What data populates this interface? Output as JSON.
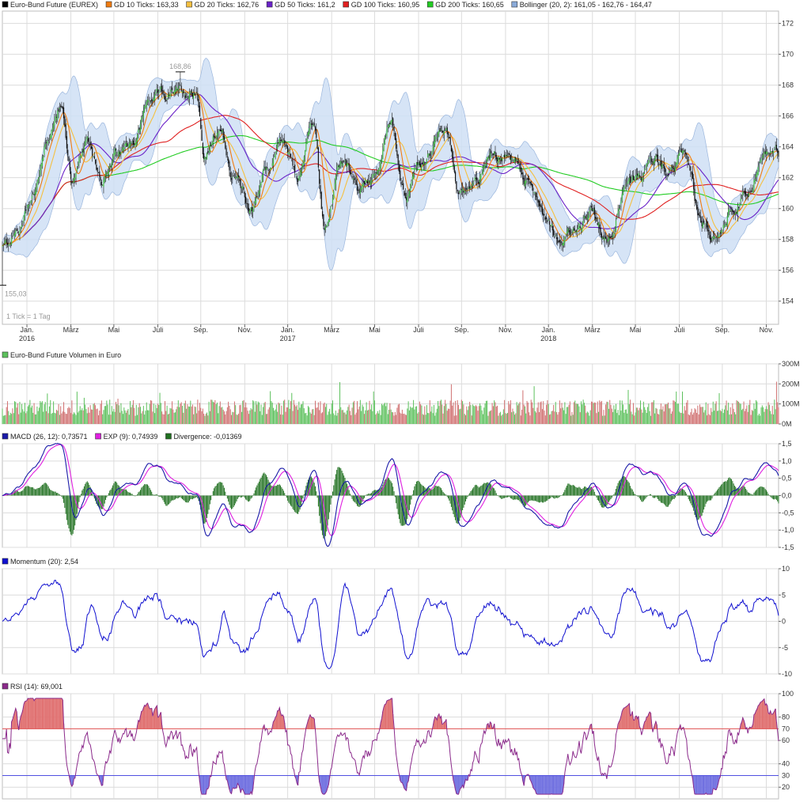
{
  "colors": {
    "ma10": "#f07b10",
    "ma20": "#f5c040",
    "ma50": "#6a22c8",
    "ma100": "#e02020",
    "ma200": "#22cc22",
    "bollinger_fill": "#cfe0f5",
    "bollinger_edge": "#8aaad8",
    "macd": "#1a1aa8",
    "exp": "#e020e0",
    "divergence": "#207020",
    "momentum": "#1010d0",
    "rsi": "#8b2a8b",
    "rsi_70": "#e05050",
    "rsi_30": "#5050e0",
    "vol_up": "#5cc05c",
    "vol_down": "#d07070",
    "grid": "#dcdcdc"
  },
  "chart_data": [
    {
      "type": "candlestick",
      "legend": [
        {
          "text": "Euro-Bund Future (EUREX)",
          "color": "#000000"
        },
        {
          "text": "GD 10 Ticks: 163,33",
          "color": "#f07b10"
        },
        {
          "text": "GD 20 Ticks: 162,76",
          "color": "#f5c040"
        },
        {
          "text": "GD 50 Ticks: 161,2",
          "color": "#6a22c8"
        },
        {
          "text": "GD 100 Ticks: 160,95",
          "color": "#e02020"
        },
        {
          "text": "GD 200 Ticks: 160,65",
          "color": "#22cc22"
        },
        {
          "text": "Bollinger (20, 2): 161,05 - 162,76 - 164,47",
          "color": "#8aaad8"
        }
      ],
      "ylim": [
        152.5,
        172.8
      ],
      "y_ticks": [
        "154",
        "156",
        "158",
        "160",
        "162",
        "164",
        "166",
        "168",
        "170",
        "172"
      ],
      "x_ticks": [
        {
          "label": "Jan.",
          "sub": "2016"
        },
        {
          "label": "März",
          "sub": ""
        },
        {
          "label": "Mai",
          "sub": ""
        },
        {
          "label": "Juli",
          "sub": ""
        },
        {
          "label": "Sep.",
          "sub": ""
        },
        {
          "label": "Nov.",
          "sub": ""
        },
        {
          "label": "Jan.",
          "sub": "2017"
        },
        {
          "label": "März",
          "sub": ""
        },
        {
          "label": "Mai",
          "sub": ""
        },
        {
          "label": "Juli",
          "sub": ""
        },
        {
          "label": "Sep.",
          "sub": ""
        },
        {
          "label": "Nov.",
          "sub": ""
        },
        {
          "label": "Jan.",
          "sub": "2018"
        },
        {
          "label": "März",
          "sub": ""
        },
        {
          "label": "Mai",
          "sub": ""
        },
        {
          "label": "Juli",
          "sub": ""
        },
        {
          "label": "Sep.",
          "sub": ""
        },
        {
          "label": "Nov.",
          "sub": ""
        }
      ],
      "annotations": {
        "high": "168,86",
        "low": "155,03",
        "scale_note": "1 Tick = 1 Tag"
      },
      "high_value": 168.86,
      "low_value": 155.03,
      "close_anchors": [
        [
          0,
          157.5
        ],
        [
          0.02,
          158.5
        ],
        [
          0.04,
          161
        ],
        [
          0.06,
          165
        ],
        [
          0.075,
          166.5
        ],
        [
          0.09,
          162
        ],
        [
          0.11,
          164
        ],
        [
          0.13,
          162
        ],
        [
          0.15,
          163.5
        ],
        [
          0.17,
          164.5
        ],
        [
          0.19,
          167
        ],
        [
          0.21,
          167.3
        ],
        [
          0.235,
          167.5
        ],
        [
          0.25,
          167.8
        ],
        [
          0.26,
          163.5
        ],
        [
          0.28,
          165
        ],
        [
          0.3,
          162
        ],
        [
          0.32,
          160
        ],
        [
          0.34,
          162.5
        ],
        [
          0.36,
          164.5
        ],
        [
          0.38,
          162
        ],
        [
          0.4,
          165.5
        ],
        [
          0.415,
          159
        ],
        [
          0.44,
          163
        ],
        [
          0.46,
          161
        ],
        [
          0.48,
          162
        ],
        [
          0.5,
          165.5
        ],
        [
          0.52,
          161
        ],
        [
          0.54,
          163
        ],
        [
          0.57,
          165
        ],
        [
          0.59,
          161
        ],
        [
          0.61,
          162
        ],
        [
          0.63,
          163.5
        ],
        [
          0.66,
          163
        ],
        [
          0.68,
          161.5
        ],
        [
          0.7,
          159.5
        ],
        [
          0.72,
          158
        ],
        [
          0.74,
          158.5
        ],
        [
          0.76,
          159.5
        ],
        [
          0.78,
          158
        ],
        [
          0.8,
          161
        ],
        [
          0.82,
          162
        ],
        [
          0.84,
          163
        ],
        [
          0.86,
          162.5
        ],
        [
          0.88,
          163.5
        ],
        [
          0.9,
          159
        ],
        [
          0.92,
          158
        ],
        [
          0.94,
          160
        ],
        [
          0.96,
          161
        ],
        [
          0.98,
          163.5
        ],
        [
          1.0,
          163.5
        ]
      ]
    },
    {
      "type": "bar",
      "legend": [
        {
          "text": "Euro-Bund Future Volumen in Euro",
          "color": "#5cc05c"
        }
      ],
      "ylim": [
        0,
        300
      ],
      "y_ticks": [
        "0M",
        "100M",
        "200M",
        "300M"
      ],
      "base_value": 90
    },
    {
      "type": "line",
      "legend": [
        {
          "text": "MACD (26, 12): 0,73571",
          "color": "#1a1aa8"
        },
        {
          "text": "EXP (9): 0,74939",
          "color": "#e020e0"
        },
        {
          "text": "Divergence: -0,01369",
          "color": "#207020"
        }
      ],
      "ylim": [
        -1.5,
        1.5
      ],
      "y_ticks": [
        "1,5",
        "1,0",
        "0,5",
        "0,0",
        "-0,5",
        "-1,0",
        "-1,5"
      ]
    },
    {
      "type": "line",
      "legend": [
        {
          "text": "Momentum (20): 2,54",
          "color": "#1010d0"
        }
      ],
      "ylim": [
        -10,
        10
      ],
      "y_ticks": [
        "10",
        "5",
        "0",
        "-5",
        "-10"
      ]
    },
    {
      "type": "line",
      "legend": [
        {
          "text": "RSI (14): 69,001",
          "color": "#8b2a8b"
        }
      ],
      "ylim": [
        10,
        100
      ],
      "y_ticks": [
        "100",
        "80",
        "60",
        "40",
        "20"
      ],
      "hlines": [
        {
          "value": 70,
          "label": "70"
        },
        {
          "value": 30,
          "label": "30"
        }
      ]
    }
  ]
}
